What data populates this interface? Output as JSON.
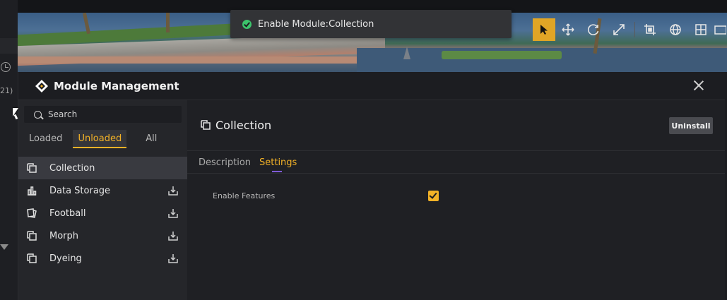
{
  "editor": {
    "counter_text": "21)"
  },
  "toast": {
    "message": "Enable Module:Collection",
    "status_color": "#3cc46b"
  },
  "toolbar": {
    "tools": [
      "select-tool",
      "move-tool",
      "rotate-tool",
      "scale-tool",
      "crop-tool",
      "globe-tool",
      "grid-tool",
      "window-tool"
    ],
    "active_color": "#e0a526"
  },
  "dialog": {
    "title": "Module Management",
    "search": {
      "placeholder": "Search"
    },
    "filters": [
      {
        "label": "Loaded",
        "active": false
      },
      {
        "label": "Unloaded",
        "active": true
      },
      {
        "label": "All",
        "active": false
      }
    ],
    "modules": [
      {
        "label": "Collection",
        "icon": "copy-icon",
        "selected": true,
        "downloadable": false
      },
      {
        "label": "Data Storage",
        "icon": "bar-chart-icon",
        "selected": false,
        "downloadable": true
      },
      {
        "label": "Football",
        "icon": "cards-icon",
        "selected": false,
        "downloadable": true
      },
      {
        "label": "Morph",
        "icon": "copy-icon",
        "selected": false,
        "downloadable": true
      },
      {
        "label": "Dyeing",
        "icon": "copy-icon",
        "selected": false,
        "downloadable": true
      }
    ],
    "detail": {
      "title": "Collection",
      "uninstall_label": "Uninstall",
      "tabs": [
        {
          "label": "Description",
          "active": false
        },
        {
          "label": "Settings",
          "active": true
        }
      ],
      "settings": {
        "enable_features_label": "Enable Features",
        "enable_features_checked": true
      }
    },
    "accent_color": "#f3b227"
  }
}
